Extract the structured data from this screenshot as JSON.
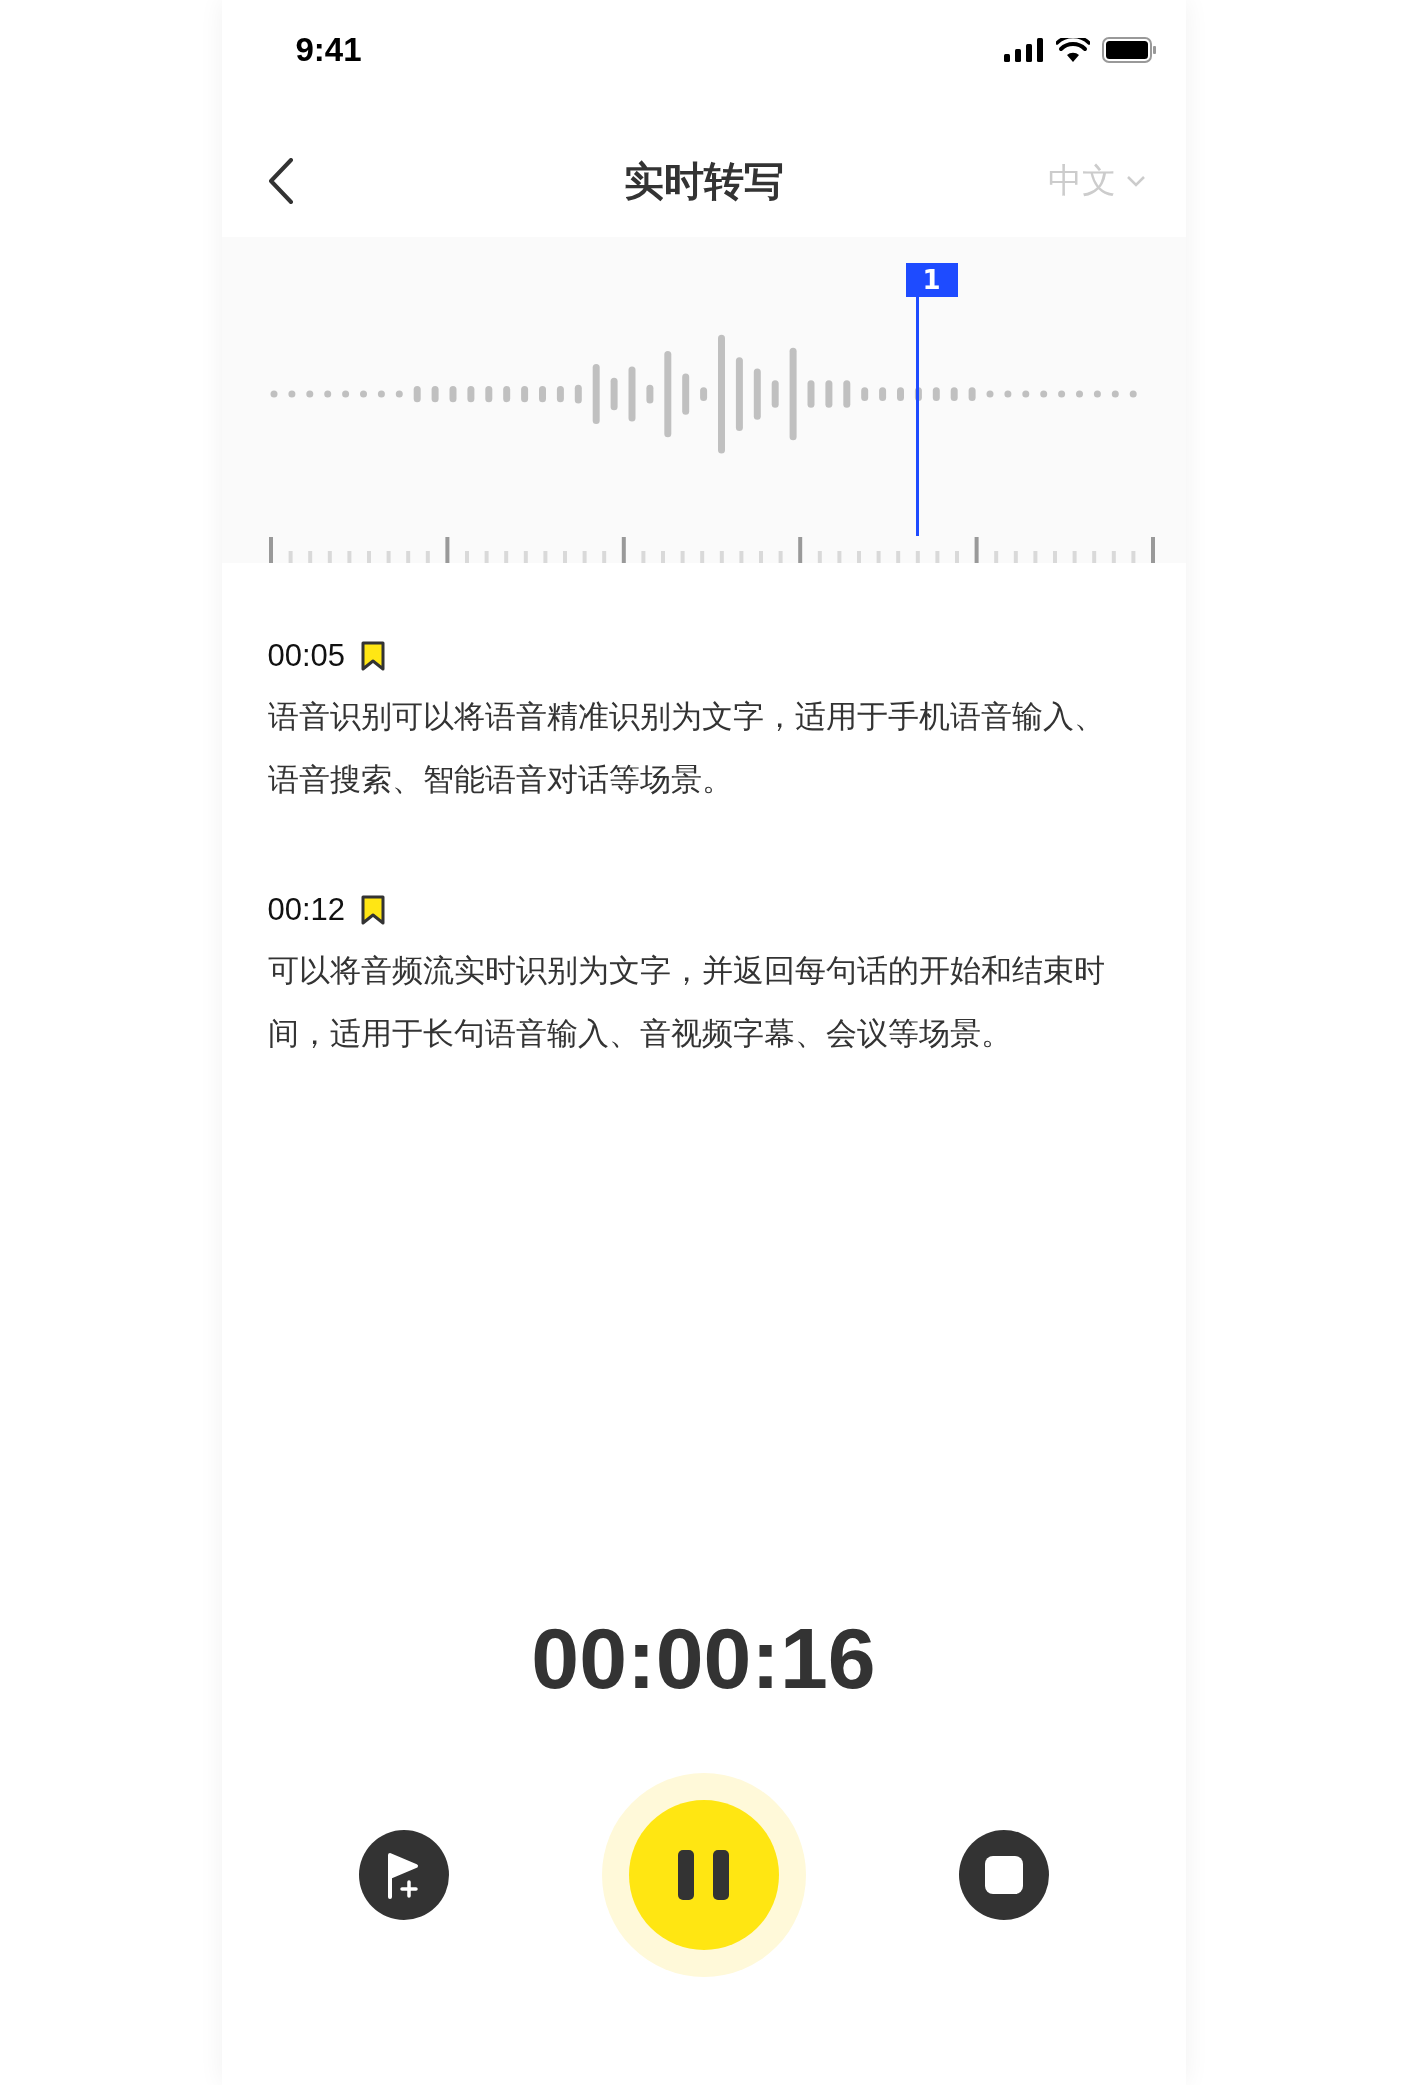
{
  "status_bar": {
    "time": "9:41"
  },
  "nav": {
    "title": "实时转写",
    "language": "中文"
  },
  "waveform": {
    "marker": "1"
  },
  "transcript": [
    {
      "time": "00:05",
      "bookmarked": true,
      "text": "语音识别可以将语音精准识别为文字，适用于手机语音输入、语音搜索、智能语音对话等场景。"
    },
    {
      "time": "00:12",
      "bookmarked": true,
      "text": "可以将音频流实时识别为文字，并返回每句话的开始和结束时间，适用于长句语音输入、音视频字幕、会议等场景。"
    }
  ],
  "timer": "00:00:16",
  "recording": true
}
